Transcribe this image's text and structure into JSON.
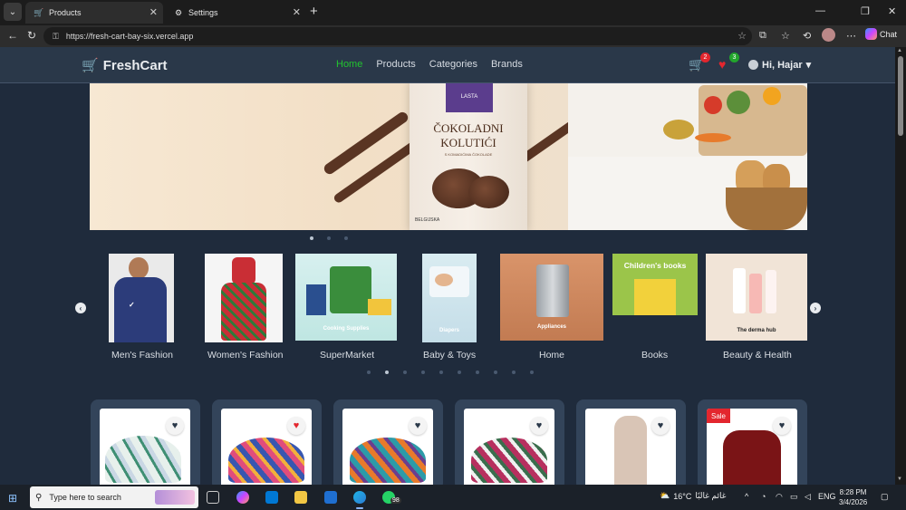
{
  "browser": {
    "tabs": [
      {
        "title": "Products",
        "active": true
      },
      {
        "title": "Settings",
        "active": false
      }
    ],
    "url": "https://fresh-cart-bay-six.vercel.app",
    "chat_label": "Chat"
  },
  "site": {
    "brand": "FreshCart",
    "nav": [
      "Home",
      "Products",
      "Categories",
      "Brands"
    ],
    "active_nav": "Home",
    "cart_count": "2",
    "wishlist_count": "3",
    "greeting": "Hi, Hajar"
  },
  "hero": {
    "pack_brand": "LASTA",
    "pack_title": "ČOKOLADNI KOLUTIĆI",
    "pack_sub": "S KOMADIĆIMA ČOKOLADE",
    "pack_origin": "BELGIJSKA",
    "slide_count": 3,
    "active_slide": 0
  },
  "categories": {
    "items": [
      {
        "label": "Men's Fashion",
        "caption": ""
      },
      {
        "label": "Women's Fashion",
        "caption": ""
      },
      {
        "label": "SuperMarket",
        "caption": "Cooking Supplies"
      },
      {
        "label": "Baby & Toys",
        "caption": "Diapers"
      },
      {
        "label": "Home",
        "caption": "Appliances"
      },
      {
        "label": "Books",
        "caption": "Children's books"
      },
      {
        "label": "Beauty & Health",
        "caption": "The derma hub"
      }
    ],
    "prev_arrow": "‹",
    "next_arrow": "›",
    "dot_count": 10,
    "active_dot": 1
  },
  "products": {
    "sale_label": "Sale",
    "items": [
      {
        "wishlisted": false,
        "sale": false
      },
      {
        "wishlisted": true,
        "sale": false
      },
      {
        "wishlisted": false,
        "sale": false
      },
      {
        "wishlisted": false,
        "sale": false
      },
      {
        "wishlisted": false,
        "sale": false
      },
      {
        "wishlisted": false,
        "sale": true
      }
    ]
  },
  "taskbar": {
    "search_placeholder": "Type here to search",
    "temperature": "16°C",
    "weather_text": "غائم غالبًا",
    "language": "ENG",
    "time": "8:28 PM",
    "date": "3/4/2026",
    "whatsapp_badge": "98"
  },
  "colors": {
    "accent_green": "#22c42f",
    "heart_red": "#e3262e",
    "page_bg": "#1f2b3c",
    "navbar_bg": "#2a3849",
    "card_bg": "#33445a"
  }
}
